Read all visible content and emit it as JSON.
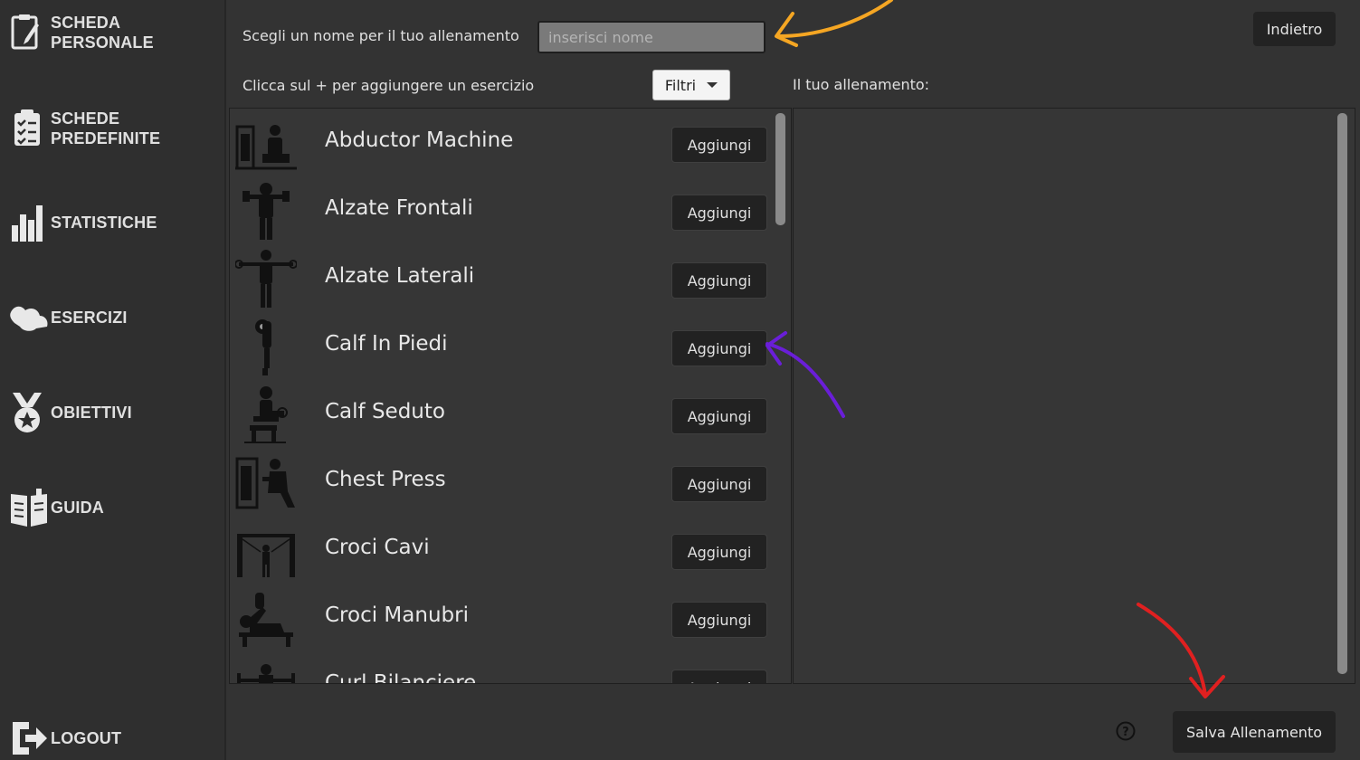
{
  "sidebar": {
    "items": [
      {
        "label": "SCHEDA PERSONALE",
        "icon": "clipboard-pen-icon"
      },
      {
        "label": "SCHEDE PREDEFINITE",
        "icon": "checklist-icon"
      },
      {
        "label": "STATISTICHE",
        "icon": "bar-chart-icon"
      },
      {
        "label": "ESERCIZI",
        "icon": "muscle-arm-icon"
      },
      {
        "label": "OBIETTIVI",
        "icon": "medal-icon"
      },
      {
        "label": "GUIDA",
        "icon": "book-icon"
      }
    ],
    "logout_label": "LOGOUT"
  },
  "header": {
    "name_prompt": "Scegli un nome per il tuo allenamento",
    "name_placeholder": "inserisci nome",
    "back_label": "Indietro",
    "add_hint": "Clicca sul + per aggiungere un esercizio",
    "filter_label": "Filtri",
    "workout_label": "Il tuo allenamento:"
  },
  "exercises": [
    {
      "name": "Abductor Machine",
      "button": "Aggiungi"
    },
    {
      "name": "Alzate Frontali",
      "button": "Aggiungi"
    },
    {
      "name": "Alzate Laterali",
      "button": "Aggiungi"
    },
    {
      "name": "Calf In Piedi",
      "button": "Aggiungi"
    },
    {
      "name": "Calf Seduto",
      "button": "Aggiungi"
    },
    {
      "name": "Chest Press",
      "button": "Aggiungi"
    },
    {
      "name": "Croci Cavi",
      "button": "Aggiungi"
    },
    {
      "name": "Croci Manubri",
      "button": "Aggiungi"
    },
    {
      "name": "Curl Bilanciere",
      "button": "Aggiungi"
    }
  ],
  "footer": {
    "help_icon": "question-circle-icon",
    "save_label": "Salva Allenamento"
  },
  "colors": {
    "background": "#333333",
    "sidebar": "#2f2f2f",
    "button": "#232323",
    "arrow_orange": "#f5a623",
    "arrow_purple": "#6a1ed8",
    "arrow_red": "#e02020"
  }
}
